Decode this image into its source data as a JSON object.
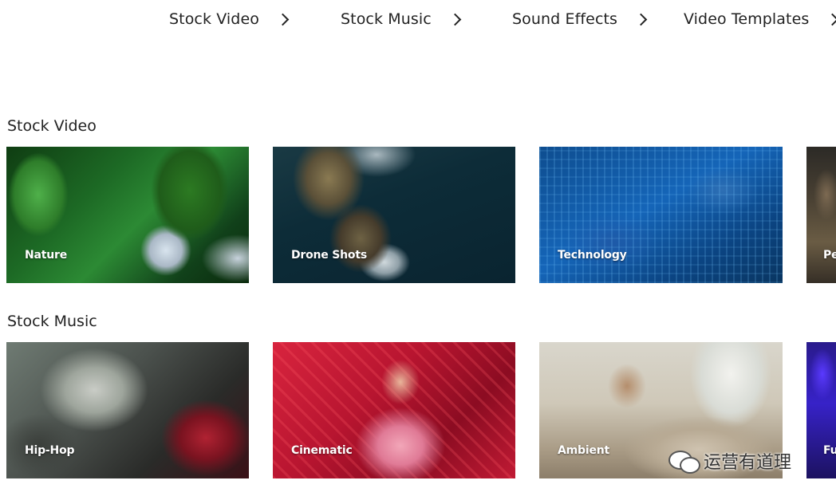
{
  "nav": {
    "items": [
      {
        "label": "Stock Video"
      },
      {
        "label": "Stock Music"
      },
      {
        "label": "Sound Effects"
      },
      {
        "label": "Video Templates"
      }
    ]
  },
  "sections": [
    {
      "title": "Stock Video",
      "cards": [
        {
          "label": "Nature"
        },
        {
          "label": "Drone Shots"
        },
        {
          "label": "Technology"
        },
        {
          "label": "Pe"
        }
      ]
    },
    {
      "title": "Stock Music",
      "cards": [
        {
          "label": "Hip-Hop"
        },
        {
          "label": "Cinematic"
        },
        {
          "label": "Ambient"
        },
        {
          "label": "Fu"
        }
      ]
    }
  ],
  "watermark": {
    "text": "运营有道理",
    "icon": "wechat-icon"
  }
}
